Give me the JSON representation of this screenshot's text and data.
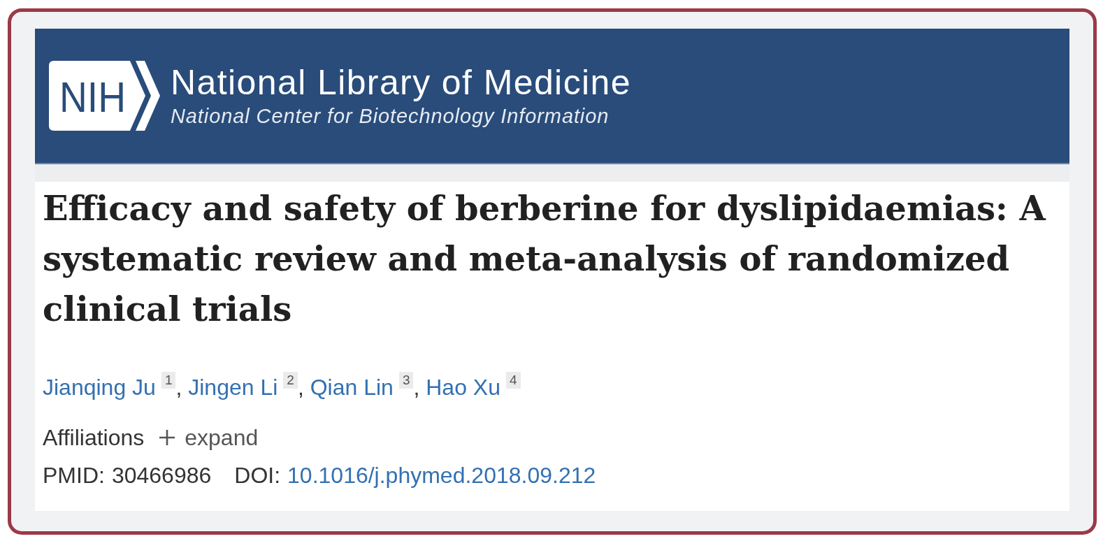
{
  "header": {
    "logo_text": "NIH",
    "title": "National Library of Medicine",
    "subtitle": "National Center for Biotechnology Information"
  },
  "article": {
    "title": "Efficacy and safety of berberine for dyslipidaemias: A systematic review and meta-analysis of randomized clinical trials",
    "authors": [
      {
        "name": "Jianqing Ju",
        "affiliation": "1"
      },
      {
        "name": "Jingen Li",
        "affiliation": "2"
      },
      {
        "name": "Qian Lin",
        "affiliation": "3"
      },
      {
        "name": "Hao Xu",
        "affiliation": "4"
      }
    ],
    "author_separator": ",",
    "affiliations": {
      "label": "Affiliations",
      "toggle": "expand",
      "expanded": false
    },
    "identifiers": [
      {
        "kind": "text",
        "label": "PMID:",
        "value": "30466986"
      },
      {
        "kind": "link",
        "label": "DOI:",
        "value": "10.1016/j.phymed.2018.09.212"
      }
    ]
  }
}
